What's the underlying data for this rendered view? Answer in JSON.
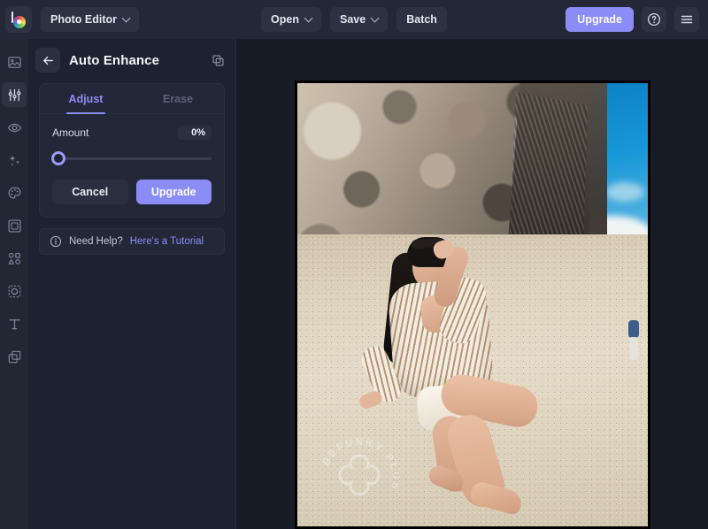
{
  "topbar": {
    "logo": "befunky-logo",
    "app_switcher": {
      "label": "Photo Editor",
      "icon": "chevron-down-icon"
    },
    "open": {
      "label": "Open",
      "icon": "chevron-down-icon"
    },
    "save": {
      "label": "Save",
      "icon": "chevron-down-icon"
    },
    "batch": {
      "label": "Batch"
    },
    "upgrade": {
      "label": "Upgrade"
    },
    "help": {
      "icon": "help-circle-icon"
    },
    "menu": {
      "icon": "hamburger-menu-icon"
    }
  },
  "rail": {
    "items": [
      {
        "name": "image",
        "icon": "image-icon",
        "active": false
      },
      {
        "name": "edit",
        "icon": "sliders-icon",
        "active": true
      },
      {
        "name": "touch-up",
        "icon": "eye-icon",
        "active": false
      },
      {
        "name": "effects",
        "icon": "sparkles-icon",
        "active": false
      },
      {
        "name": "artsy",
        "icon": "palette-icon",
        "active": false
      },
      {
        "name": "frames",
        "icon": "frame-icon",
        "active": false
      },
      {
        "name": "graphics",
        "icon": "shapes-icon",
        "active": false
      },
      {
        "name": "overlays",
        "icon": "cutout-icon",
        "active": false
      },
      {
        "name": "text",
        "icon": "text-icon",
        "active": false
      },
      {
        "name": "layers",
        "icon": "layers-icon",
        "active": false
      }
    ]
  },
  "panel": {
    "back_icon": "arrow-left-icon",
    "title": "Auto Enhance",
    "duplicate_icon": "copy-layers-icon",
    "tabs": [
      {
        "label": "Adjust",
        "active": true
      },
      {
        "label": "Erase",
        "active": false
      }
    ],
    "amount": {
      "label": "Amount",
      "value": "0%",
      "percent": 0
    },
    "cancel_label": "Cancel",
    "upgrade_label": "Upgrade",
    "help": {
      "icon": "info-icon",
      "text": "Need Help?",
      "link": "Here's a Tutorial"
    }
  },
  "canvas": {
    "watermark": "BEFUNKY PLUS",
    "photo_description": "Woman in striped shirt sitting on sand beach in front of rocky cliff with blue sky"
  },
  "colors": {
    "accent": "#8b8cf5",
    "topbar_bg": "#242836",
    "panel_bg": "#1e2230",
    "stage_bg": "#181c26",
    "rail_bg": "#232734"
  }
}
